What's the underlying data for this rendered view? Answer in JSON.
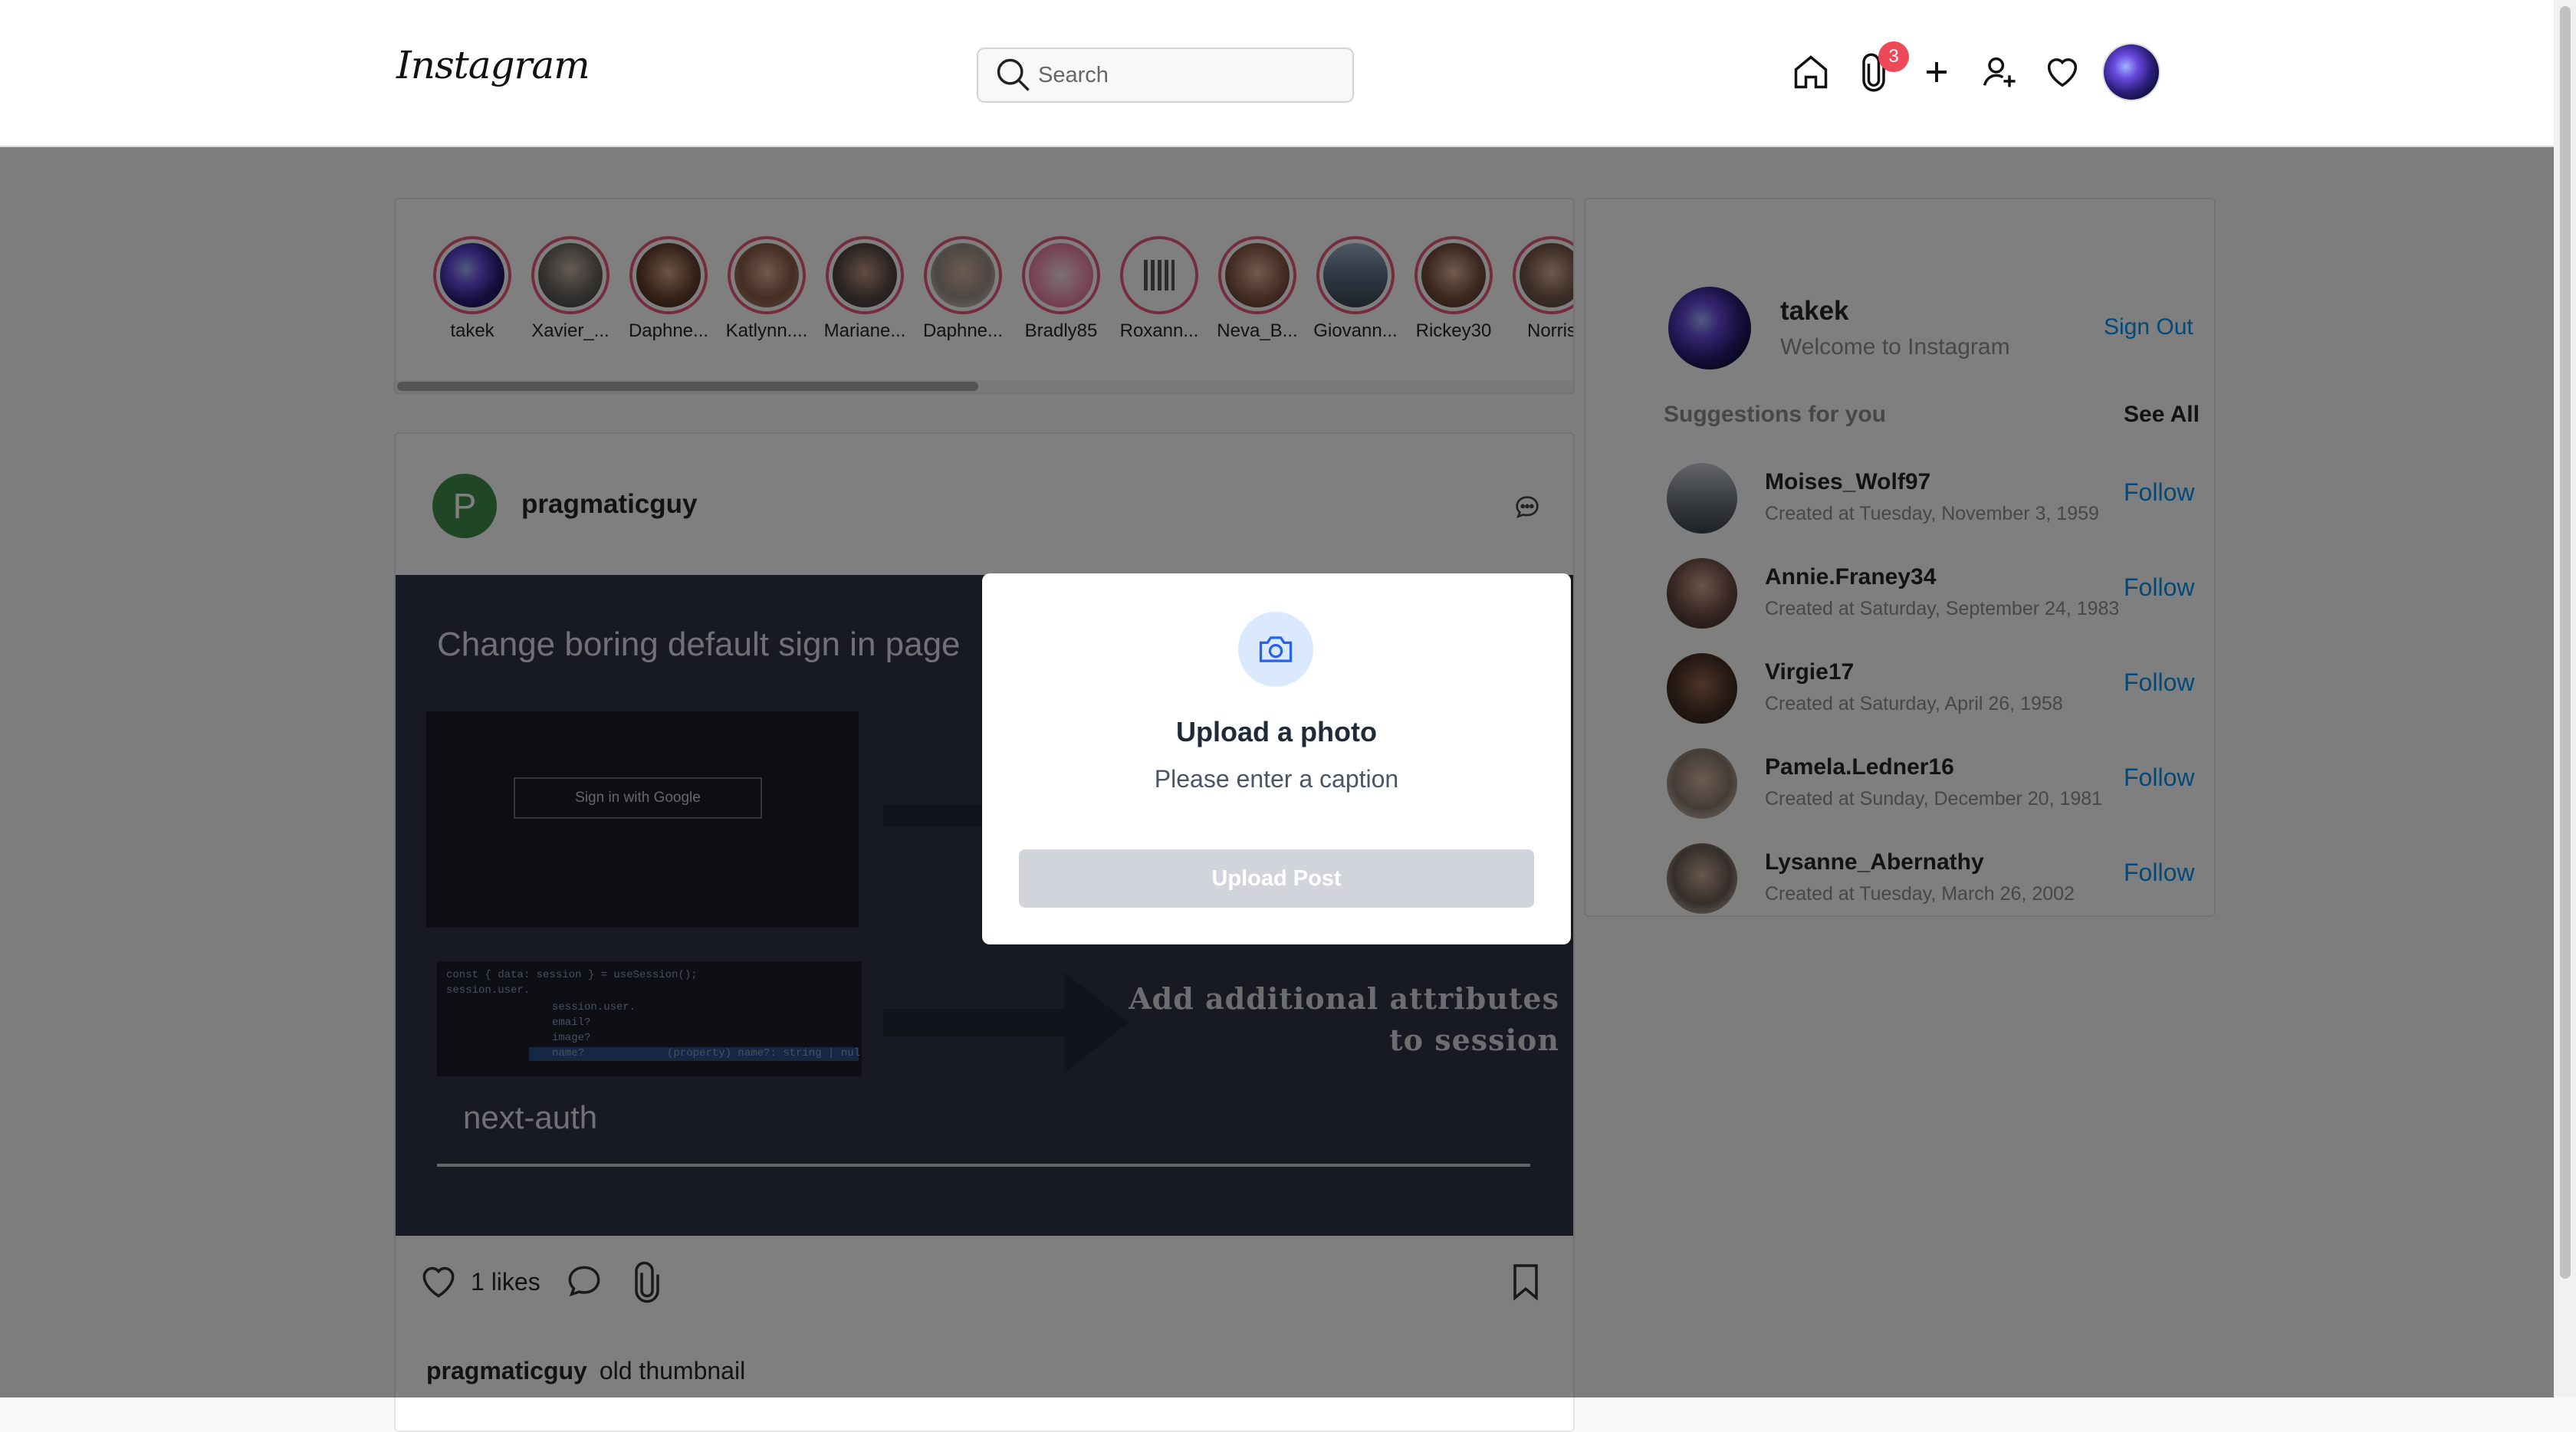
{
  "header": {
    "logo": "Instagram",
    "search_placeholder": "Search",
    "notification_badge": "3",
    "icons": [
      "home-icon",
      "paperclip-icon",
      "plus-icon",
      "add-user-icon",
      "heart-icon"
    ]
  },
  "stories": [
    {
      "name": "takek"
    },
    {
      "name": "Xavier_..."
    },
    {
      "name": "Daphne..."
    },
    {
      "name": "Katlynn...."
    },
    {
      "name": "Mariane..."
    },
    {
      "name": "Daphne..."
    },
    {
      "name": "Bradly85"
    },
    {
      "name": "Roxann..."
    },
    {
      "name": "Neva_B..."
    },
    {
      "name": "Giovann..."
    },
    {
      "name": "Rickey30"
    },
    {
      "name": "Norris"
    }
  ],
  "post": {
    "avatar_letter": "P",
    "username": "pragmaticguy",
    "image": {
      "title": "Change boring default sign in page",
      "button_text": "Sign in with Google",
      "code_lines": [
        "const { data: session } = useSession();",
        "session.user.",
        "session.user.",
        "email?",
        "image?",
        "name?",
        "(property) name?: string | null | "
      ],
      "caption2_line1": "Add additional attributes",
      "caption2_line2": "to session",
      "library": "next-auth"
    },
    "likes": "1 likes",
    "caption_user": "pragmaticguy",
    "caption_text": "old thumbnail"
  },
  "sidebar": {
    "username": "takek",
    "welcome": "Welcome to Instagram",
    "sign_out": "Sign Out",
    "suggestions_heading": "Suggestions for you",
    "see_all": "See All",
    "follow_label": "Follow",
    "suggestions": [
      {
        "username": "Moises_Wolf97",
        "created": "Created at Tuesday, November 3, 1959"
      },
      {
        "username": "Annie.Franey34",
        "created": "Created at Saturday, September 24, 1983"
      },
      {
        "username": "Virgie17",
        "created": "Created at Saturday, April 26, 1958"
      },
      {
        "username": "Pamela.Ledner16",
        "created": "Created at Sunday, December 20, 1981"
      },
      {
        "username": "Lysanne_Abernathy",
        "created": "Created at Tuesday, March 26, 2002"
      }
    ]
  },
  "modal": {
    "title": "Upload a photo",
    "subtitle": "Please enter a caption",
    "button": "Upload Post"
  },
  "colors": {
    "accent": "#0095f6",
    "story_ring": "#e85a7a",
    "badge": "#ed4956",
    "modal_button": "#d1d5db",
    "camera_circle": "#dbe9fe",
    "camera_icon": "#2563eb"
  }
}
